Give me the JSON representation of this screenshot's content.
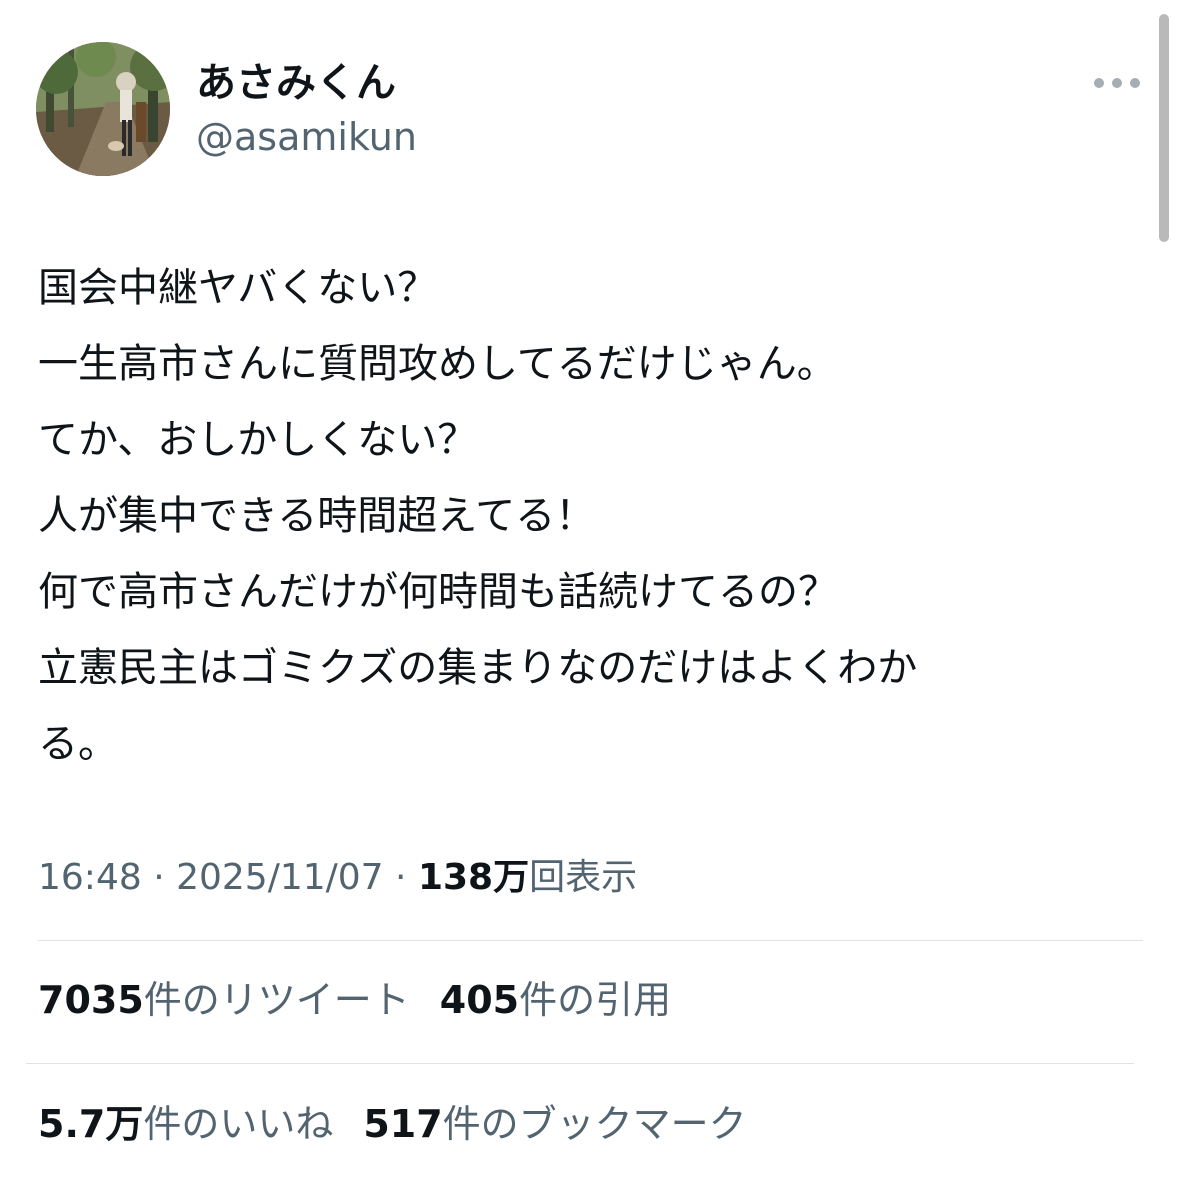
{
  "author": {
    "display_name": "あさみくん",
    "handle": "@asamikun"
  },
  "tweet": {
    "lines": [
      "国会中継ヤバくない？",
      "一生高市さんに質問攻めしてるだけじゃん。",
      "てか、おしかしくない？",
      "人が集中できる時間超えてる！",
      "何で高市さんだけが何時間も話続けてるの？",
      "立憲民主はゴミクズの集まりなのだけはよくわか",
      "る。"
    ]
  },
  "meta": {
    "time": "16:48",
    "separator": " · ",
    "date": "2025/11/07",
    "views_count": "138万",
    "views_label": "回表示"
  },
  "stats": {
    "retweets": {
      "count": "7035",
      "label": "件のリツイート"
    },
    "quotes": {
      "count": "405",
      "label": "件の引用"
    },
    "likes": {
      "count": "5.7万",
      "label": "件のいいね"
    },
    "bookmarks": {
      "count": "517",
      "label": "件のブックマーク"
    }
  },
  "icons": {
    "more": "more-horizontal-icon"
  },
  "colors": {
    "text_primary": "#0f1419",
    "text_secondary": "#536471",
    "divider": "#dfe3e6"
  }
}
